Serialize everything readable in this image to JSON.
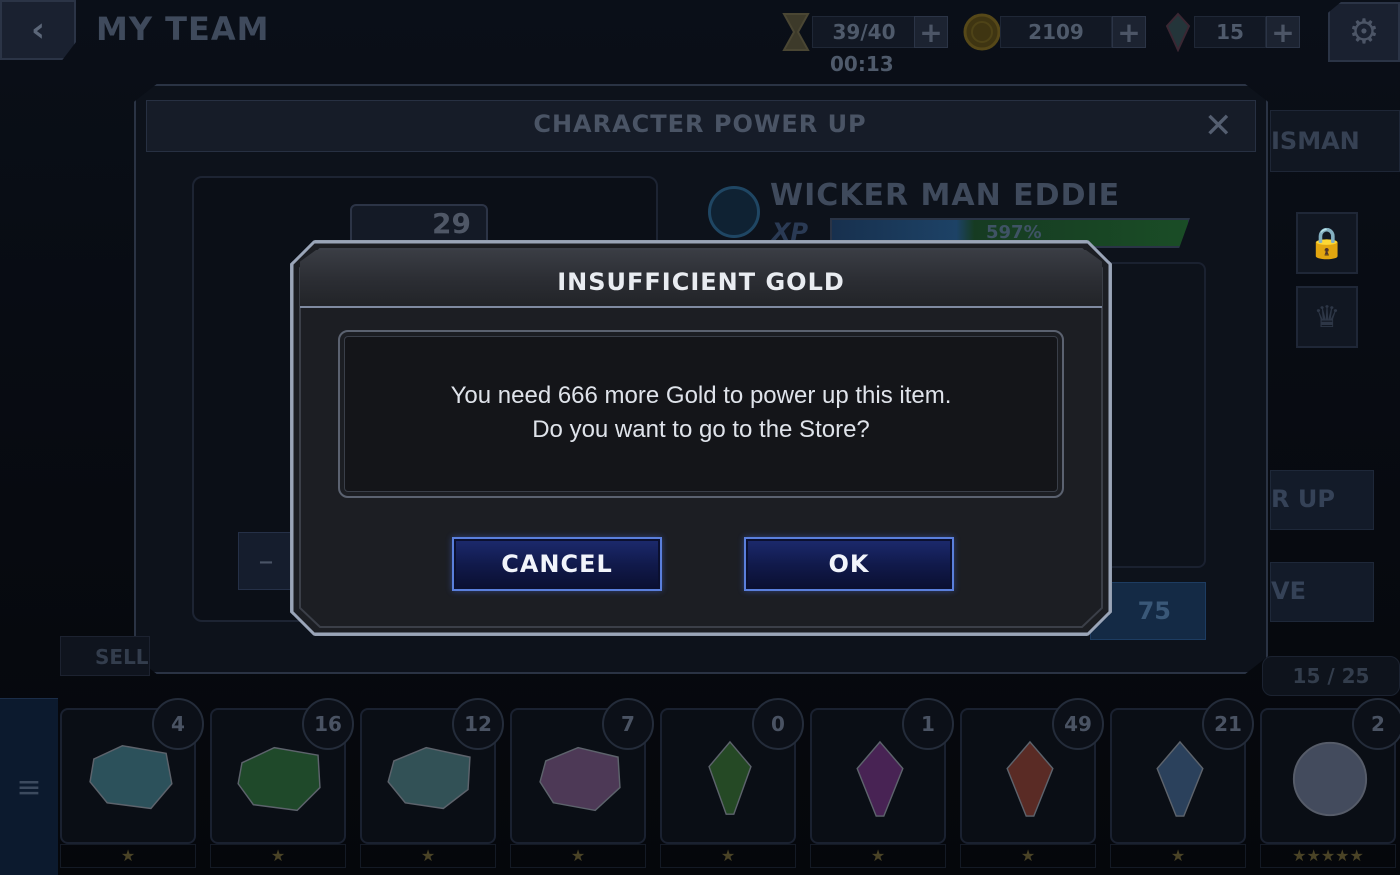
{
  "header": {
    "title": "MY TEAM",
    "energy": "39/40",
    "energy_timer": "00:13",
    "gold": "2109",
    "crystals": "15",
    "energy_icon": "hourglass-icon",
    "gold_icon": "gold-coin-icon",
    "crystal_icon": "crystal-shard-icon"
  },
  "power_up": {
    "title": "CHARACTER POWER UP",
    "level": "29",
    "hero_name": "WICKER MAN EDDIE",
    "xp_label": "XP",
    "xp_percent": "597%",
    "cost": "75",
    "sell_label": "SELL"
  },
  "side": {
    "tab_label": "ISMAN",
    "power_up_label": "R UP",
    "move_label": "VE",
    "page": "15 / 25"
  },
  "modal": {
    "title": "INSUFFICIENT GOLD",
    "line1": "You need 666 more Gold to power up this item.",
    "line2": "Do you want to go to the Store?",
    "cancel_label": "CANCEL",
    "ok_label": "OK"
  },
  "inventory": [
    {
      "count": "4",
      "stars": "★",
      "color": "#5fb7c4"
    },
    {
      "count": "16",
      "stars": "★",
      "color": "#3fa24a"
    },
    {
      "count": "12",
      "stars": "★",
      "color": "#6fb7b9"
    },
    {
      "count": "7",
      "stars": "★",
      "color": "#b27ab9"
    },
    {
      "count": "0",
      "stars": "★",
      "color": "#4fa13e"
    },
    {
      "count": "1",
      "stars": "★",
      "color": "#a544b4"
    },
    {
      "count": "49",
      "stars": "★",
      "color": "#d2573e"
    },
    {
      "count": "21",
      "stars": "★",
      "color": "#5e8fc6"
    },
    {
      "count": "2",
      "stars": "★★★★★",
      "color": "#9aa6c8"
    }
  ],
  "colors": {
    "button_border": "#5a7fdc",
    "modal_border": "#8c97a9"
  }
}
